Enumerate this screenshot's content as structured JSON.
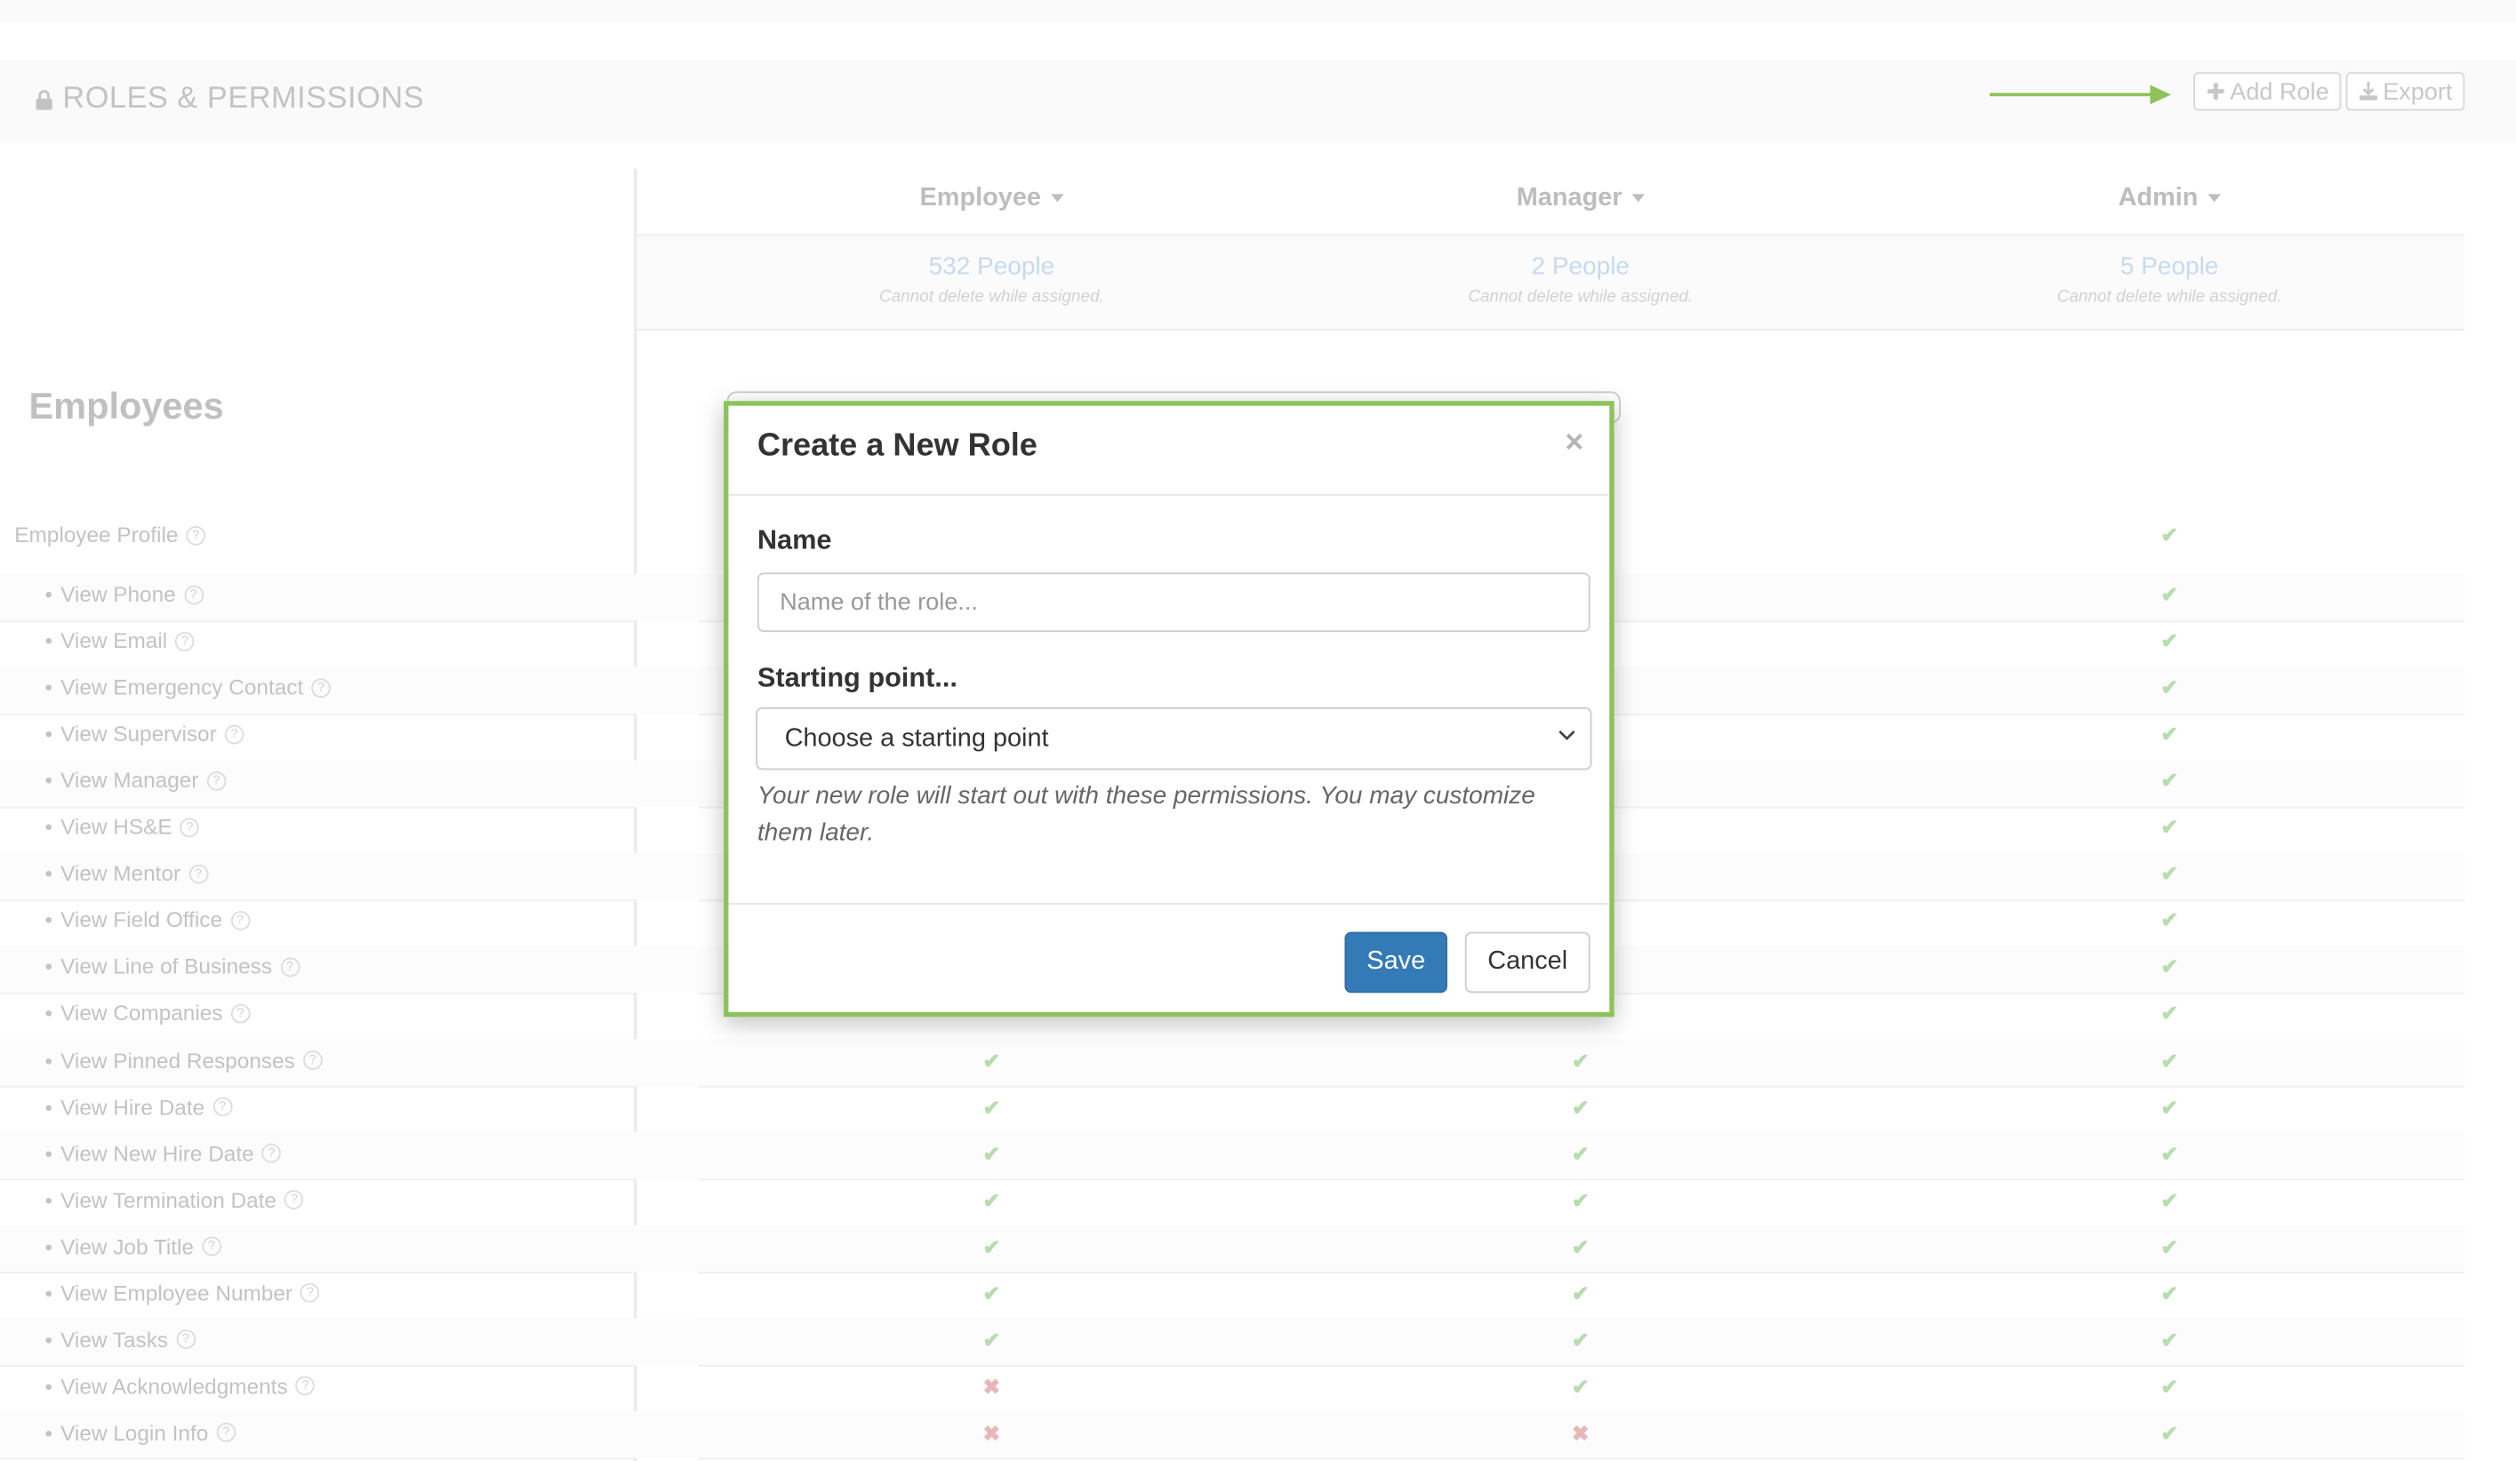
{
  "page": {
    "title": "ROLES & PERMISSIONS"
  },
  "toolbar": {
    "add_role_label": "Add Role",
    "export_label": "Export"
  },
  "roles": [
    {
      "name": "Employee",
      "people": "532 People",
      "note": "Cannot delete while assigned."
    },
    {
      "name": "Manager",
      "people": "2 People",
      "note": "Cannot delete while assigned."
    },
    {
      "name": "Admin",
      "people": "5 People",
      "note": "Cannot delete while assigned."
    }
  ],
  "section": {
    "title": "Employees"
  },
  "permissions": [
    {
      "label": "Employee Profile",
      "bullet": false,
      "marks": [
        "",
        "",
        "yes"
      ]
    },
    {
      "label": "View Phone",
      "bullet": true,
      "marks": [
        "",
        "",
        "yes"
      ]
    },
    {
      "label": "View Email",
      "bullet": true,
      "marks": [
        "",
        "",
        "yes"
      ]
    },
    {
      "label": "View Emergency Contact",
      "bullet": true,
      "marks": [
        "",
        "",
        "yes"
      ]
    },
    {
      "label": "View Supervisor",
      "bullet": true,
      "marks": [
        "",
        "",
        "yes"
      ]
    },
    {
      "label": "View Manager",
      "bullet": true,
      "marks": [
        "",
        "",
        "yes"
      ]
    },
    {
      "label": "View HS&E",
      "bullet": true,
      "marks": [
        "",
        "",
        "yes"
      ]
    },
    {
      "label": "View Mentor",
      "bullet": true,
      "marks": [
        "",
        "",
        "yes"
      ]
    },
    {
      "label": "View Field Office",
      "bullet": true,
      "marks": [
        "",
        "",
        "yes"
      ]
    },
    {
      "label": "View Line of Business",
      "bullet": true,
      "marks": [
        "",
        "",
        "yes"
      ]
    },
    {
      "label": "View Companies",
      "bullet": true,
      "marks": [
        "",
        "",
        "yes"
      ]
    },
    {
      "label": "View Pinned Responses",
      "bullet": true,
      "marks": [
        "yes",
        "yes",
        "yes"
      ]
    },
    {
      "label": "View Hire Date",
      "bullet": true,
      "marks": [
        "yes",
        "yes",
        "yes"
      ]
    },
    {
      "label": "View New Hire Date",
      "bullet": true,
      "marks": [
        "yes",
        "yes",
        "yes"
      ]
    },
    {
      "label": "View Termination Date",
      "bullet": true,
      "marks": [
        "yes",
        "yes",
        "yes"
      ]
    },
    {
      "label": "View Job Title",
      "bullet": true,
      "marks": [
        "yes",
        "yes",
        "yes"
      ]
    },
    {
      "label": "View Employee Number",
      "bullet": true,
      "marks": [
        "yes",
        "yes",
        "yes"
      ]
    },
    {
      "label": "View Tasks",
      "bullet": true,
      "marks": [
        "yes",
        "yes",
        "yes"
      ]
    },
    {
      "label": "View Acknowledgments",
      "bullet": true,
      "marks": [
        "no",
        "yes",
        "yes"
      ]
    },
    {
      "label": "View Login Info",
      "bullet": true,
      "marks": [
        "no",
        "no",
        "yes"
      ]
    }
  ],
  "modal": {
    "title": "Create a New Role",
    "close_glyph": "×",
    "name_label": "Name",
    "name_placeholder": "Name of the role...",
    "name_value": "",
    "start_label": "Starting point...",
    "start_value": "Choose a starting point",
    "help_text": "Your new role will start out with these permissions. You may customize them later.",
    "save_label": "Save",
    "cancel_label": "Cancel"
  },
  "icons": {
    "title": "lock-icon",
    "add": "plus-icon",
    "export": "download-icon",
    "pointer": "arrow-right-icon",
    "help": "question-circle-icon",
    "granted": "check-icon",
    "denied": "x-icon",
    "select": "chevron-down-icon"
  },
  "colors": {
    "accent_green": "#8ec25a",
    "primary_blue": "#337ab7",
    "check_green": "#b7dcae",
    "deny_red": "#e8b7b7",
    "people_link": "#c6daf0"
  }
}
